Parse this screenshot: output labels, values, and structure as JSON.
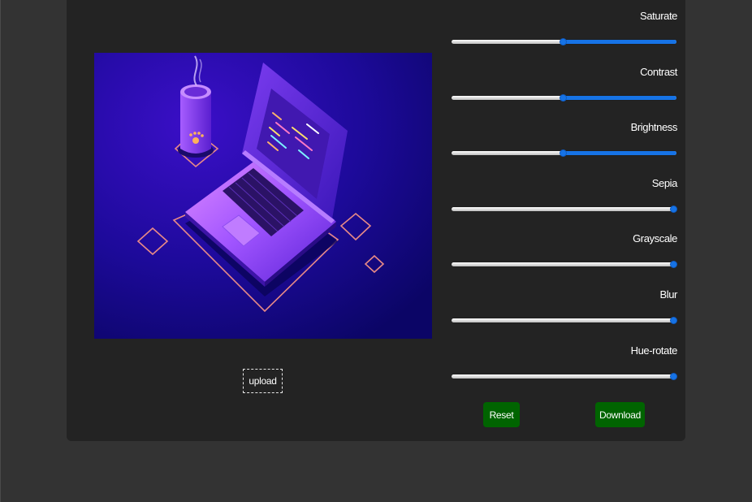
{
  "upload": {
    "label": "upload"
  },
  "sliders": [
    {
      "label": "Saturate",
      "value": 0.5
    },
    {
      "label": "Contrast",
      "value": 0.5
    },
    {
      "label": "Brightness",
      "value": 0.5
    },
    {
      "label": "Sepia",
      "value": 1.0
    },
    {
      "label": "Grayscale",
      "value": 1.0
    },
    {
      "label": "Blur",
      "value": 1.0
    },
    {
      "label": "Hue-rotate",
      "value": 1.0
    }
  ],
  "actions": {
    "reset_label": "Reset",
    "download_label": "Download"
  },
  "colors": {
    "page_bg": "#333333",
    "card_bg": "#232323",
    "accent": "#1673e6",
    "button_green": "#006400"
  }
}
